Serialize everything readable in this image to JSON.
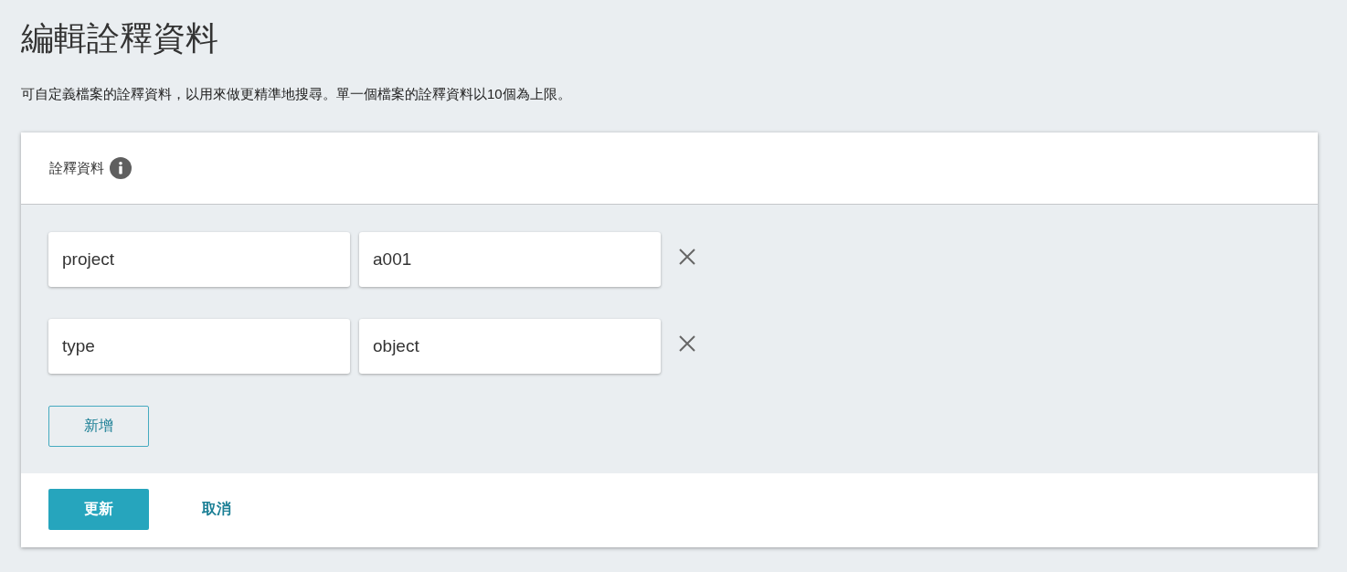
{
  "page": {
    "title": "編輯詮釋資料",
    "description": "可自定義檔案的詮釋資料，以用來做更精準地搜尋。單一個檔案的詮釋資料以10個為上限。"
  },
  "panel": {
    "title": "詮釋資料",
    "entries": [
      {
        "key": "project",
        "value": "a001"
      },
      {
        "key": "type",
        "value": "object"
      }
    ],
    "add_button": "新增"
  },
  "footer": {
    "buttons": [
      {
        "label": "更新",
        "kind": "primary"
      },
      {
        "label": "取消",
        "kind": "link"
      }
    ]
  }
}
